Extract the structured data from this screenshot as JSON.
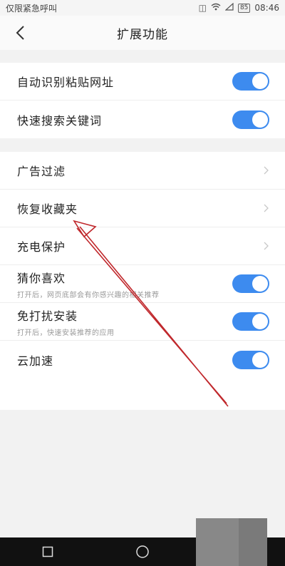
{
  "status_bar": {
    "carrier_text": "仅限紧急呼叫",
    "battery": "85",
    "time": "08:46"
  },
  "header": {
    "title": "扩展功能"
  },
  "group1": {
    "items": [
      {
        "label": "自动识别粘贴网址",
        "toggle_on": true
      },
      {
        "label": "快速搜索关键词",
        "toggle_on": true
      }
    ]
  },
  "group2": {
    "items": [
      {
        "label": "广告过滤",
        "control": "chevron"
      },
      {
        "label": "恢复收藏夹",
        "control": "chevron"
      },
      {
        "label": "充电保护",
        "control": "chevron"
      },
      {
        "label": "猜你喜欢",
        "sub": "打开后，网页底部会有你感兴趣的相关推荐",
        "toggle_on": true
      },
      {
        "label": "免打扰安装",
        "sub": "打开后，快速安装推荐的应用",
        "toggle_on": true
      },
      {
        "label": "云加速",
        "toggle_on": true
      }
    ]
  },
  "colors": {
    "toggle_on": "#3d8bef",
    "annotation_arrow": "#c0282c"
  }
}
